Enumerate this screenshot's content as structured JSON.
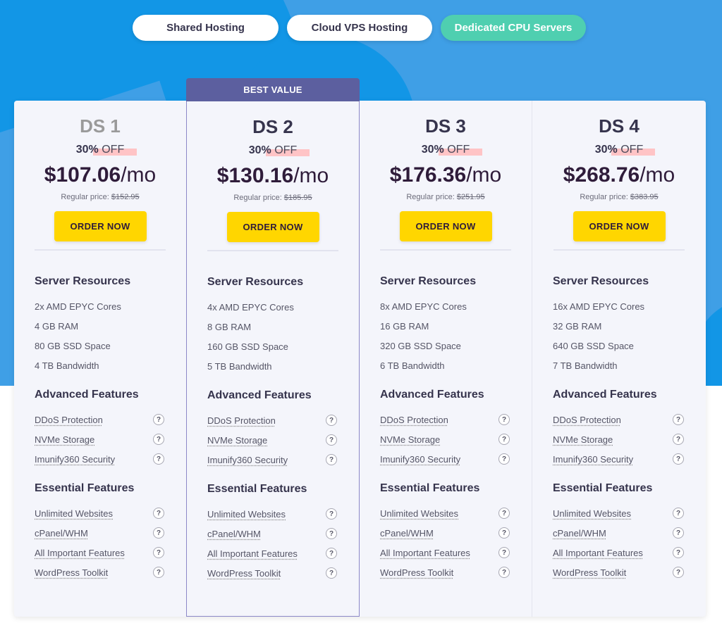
{
  "tabs": [
    {
      "label": "Shared Hosting",
      "active": false
    },
    {
      "label": "Cloud VPS Hosting",
      "active": false
    },
    {
      "label": "Dedicated CPU Servers",
      "active": true
    }
  ],
  "colors": {
    "hero_background": "#3f9fe6",
    "active_tab": "#4fcfb0",
    "ribbon": "#5c5f9f",
    "order_button": "#ffd600",
    "discount_highlight": "#ffc4c6"
  },
  "section_titles": {
    "resources": "Server Resources",
    "advanced": "Advanced Features",
    "essential": "Essential Features"
  },
  "help_icon_glyph": "?",
  "plans": [
    {
      "name": "DS 1",
      "discount_pct": "30%",
      "discount_label": "OFF",
      "price": "$107.06",
      "period": "/mo",
      "regular_label": "Regular price:",
      "regular_price": "$152.95",
      "order_label": "ORDER NOW",
      "resources": [
        "2x AMD EPYC Cores",
        "4 GB RAM",
        "80 GB SSD Space",
        "4 TB Bandwidth"
      ],
      "advanced": [
        "DDoS Protection",
        "NVMe Storage",
        "Imunify360 Security"
      ],
      "essential": [
        "Unlimited Websites",
        "cPanel/WHM",
        "All Important Features",
        "WordPress Toolkit"
      ]
    },
    {
      "name": "DS 2",
      "ribbon": "BEST VALUE",
      "discount_pct": "30%",
      "discount_label": "OFF",
      "price": "$130.16",
      "period": "/mo",
      "regular_label": "Regular price:",
      "regular_price": "$185.95",
      "order_label": "ORDER NOW",
      "resources": [
        "4x AMD EPYC Cores",
        "8 GB RAM",
        "160 GB SSD Space",
        "5 TB Bandwidth"
      ],
      "advanced": [
        "DDoS Protection",
        "NVMe Storage",
        "Imunify360 Security"
      ],
      "essential": [
        "Unlimited Websites",
        "cPanel/WHM",
        "All Important Features",
        "WordPress Toolkit"
      ]
    },
    {
      "name": "DS 3",
      "discount_pct": "30%",
      "discount_label": "OFF",
      "price": "$176.36",
      "period": "/mo",
      "regular_label": "Regular price:",
      "regular_price": "$251.95",
      "order_label": "ORDER NOW",
      "resources": [
        "8x AMD EPYC Cores",
        "16 GB RAM",
        "320 GB SSD Space",
        "6 TB Bandwidth"
      ],
      "advanced": [
        "DDoS Protection",
        "NVMe Storage",
        "Imunify360 Security"
      ],
      "essential": [
        "Unlimited Websites",
        "cPanel/WHM",
        "All Important Features",
        "WordPress Toolkit"
      ]
    },
    {
      "name": "DS 4",
      "discount_pct": "30%",
      "discount_label": "OFF",
      "price": "$268.76",
      "period": "/mo",
      "regular_label": "Regular price:",
      "regular_price": "$383.95",
      "order_label": "ORDER NOW",
      "resources": [
        "16x AMD EPYC Cores",
        "32 GB RAM",
        "640 GB SSD Space",
        "7 TB Bandwidth"
      ],
      "advanced": [
        "DDoS Protection",
        "NVMe Storage",
        "Imunify360 Security"
      ],
      "essential": [
        "Unlimited Websites",
        "cPanel/WHM",
        "All Important Features",
        "WordPress Toolkit"
      ]
    }
  ]
}
